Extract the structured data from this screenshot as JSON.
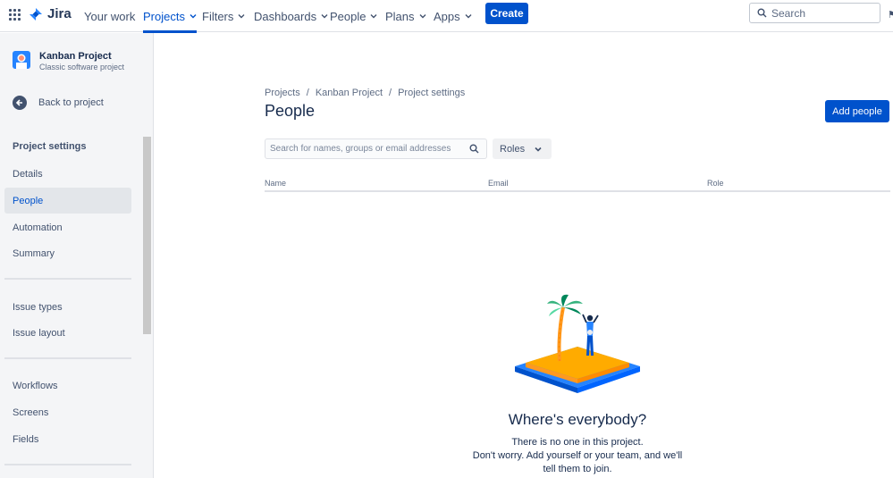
{
  "topnav": {
    "product": "Jira",
    "items": [
      {
        "label": "Your work",
        "chevron": false
      },
      {
        "label": "Projects",
        "chevron": true,
        "active": true
      },
      {
        "label": "Filters",
        "chevron": true
      },
      {
        "label": "Dashboards",
        "chevron": true
      },
      {
        "label": "People",
        "chevron": true
      },
      {
        "label": "Plans",
        "chevron": true
      },
      {
        "label": "Apps",
        "chevron": true
      }
    ],
    "create_label": "Create",
    "search_placeholder": "Search",
    "accent": "#0052cc"
  },
  "sidebar": {
    "project_name": "Kanban Project",
    "project_type": "Classic software project",
    "back_label": "Back to project",
    "heading": "Project settings",
    "items": [
      {
        "label": "Details"
      },
      {
        "label": "People",
        "selected": true
      },
      {
        "label": "Automation"
      },
      {
        "label": "Summary"
      },
      {
        "label": "Issue types"
      },
      {
        "label": "Issue layout"
      },
      {
        "label": "Workflows"
      },
      {
        "label": "Screens"
      },
      {
        "label": "Fields"
      }
    ]
  },
  "main": {
    "breadcrumb": [
      "Projects",
      "Kanban Project",
      "Project settings"
    ],
    "title": "People",
    "add_people_label": "Add people",
    "search_placeholder": "Search for names, groups or email addresses",
    "roles_label": "Roles",
    "columns": [
      "Name",
      "Email",
      "Role"
    ],
    "empty_title": "Where's everybody?",
    "empty_line1": "There is no one in this project.",
    "empty_line2": "Don't worry. Add yourself or your team, and we'll",
    "empty_line3": "tell them to join."
  }
}
